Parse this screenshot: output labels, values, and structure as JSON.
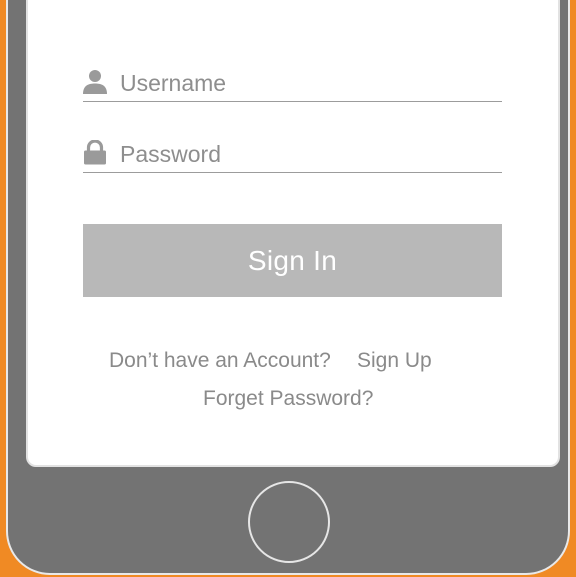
{
  "login_form": {
    "username": {
      "placeholder": "Username",
      "value": "",
      "icon": "user-icon"
    },
    "password": {
      "placeholder": "Password",
      "value": "",
      "icon": "lock-icon"
    },
    "sign_in_label": "Sign In"
  },
  "footer_links": {
    "account_prompt": "Don’t have an Account?",
    "sign_up_label": "Sign Up",
    "forget_password_label": "Forget Password?"
  },
  "device": {
    "home_button_icon": "home-button-circle"
  },
  "colors": {
    "background": "#f08a24",
    "bezel": "#737373",
    "screen": "#ffffff",
    "button": "#b8b8b8",
    "text_muted": "#8a8a8a"
  }
}
